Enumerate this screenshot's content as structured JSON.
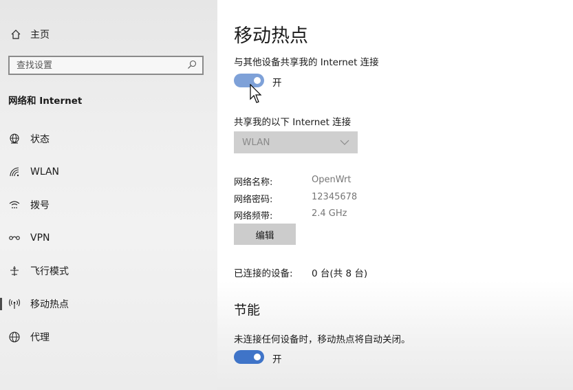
{
  "sidebar": {
    "home_label": "主页",
    "search_placeholder": "查找设置",
    "section_title": "网络和 Internet",
    "items": [
      {
        "label": "状态",
        "icon": "status-globe-icon"
      },
      {
        "label": "WLAN",
        "icon": "wifi-icon"
      },
      {
        "label": "拨号",
        "icon": "dialup-icon"
      },
      {
        "label": "VPN",
        "icon": "vpn-icon"
      },
      {
        "label": "飞行模式",
        "icon": "airplane-icon"
      },
      {
        "label": "移动热点",
        "icon": "hotspot-icon",
        "active": true
      },
      {
        "label": "代理",
        "icon": "proxy-globe-icon"
      }
    ]
  },
  "main": {
    "title": "移动热点",
    "share_label": "与其他设备共享我的 Internet 连接",
    "share_toggle": {
      "state": "开",
      "on": true
    },
    "share_from_label": "共享我的以下 Internet 连接",
    "share_from_value": "WLAN",
    "network_name_label": "网络名称:",
    "network_name_value": "OpenWrt",
    "password_label": "网络密码:",
    "password_value": "12345678",
    "band_label": "网络频带:",
    "band_value": "2.4 GHz",
    "edit_button": "编辑",
    "connected_label": "已连接的设备:",
    "connected_value": "0 台(共 8 台)",
    "power_title": "节能",
    "power_desc": "未连接任何设备时，移动热点将自动关闭。",
    "power_toggle": {
      "state": "开",
      "on": true
    }
  },
  "colors": {
    "accent": "#3f74c8",
    "sidebar_bg": "#efefef",
    "disabled_select": "#cfcfcf"
  }
}
